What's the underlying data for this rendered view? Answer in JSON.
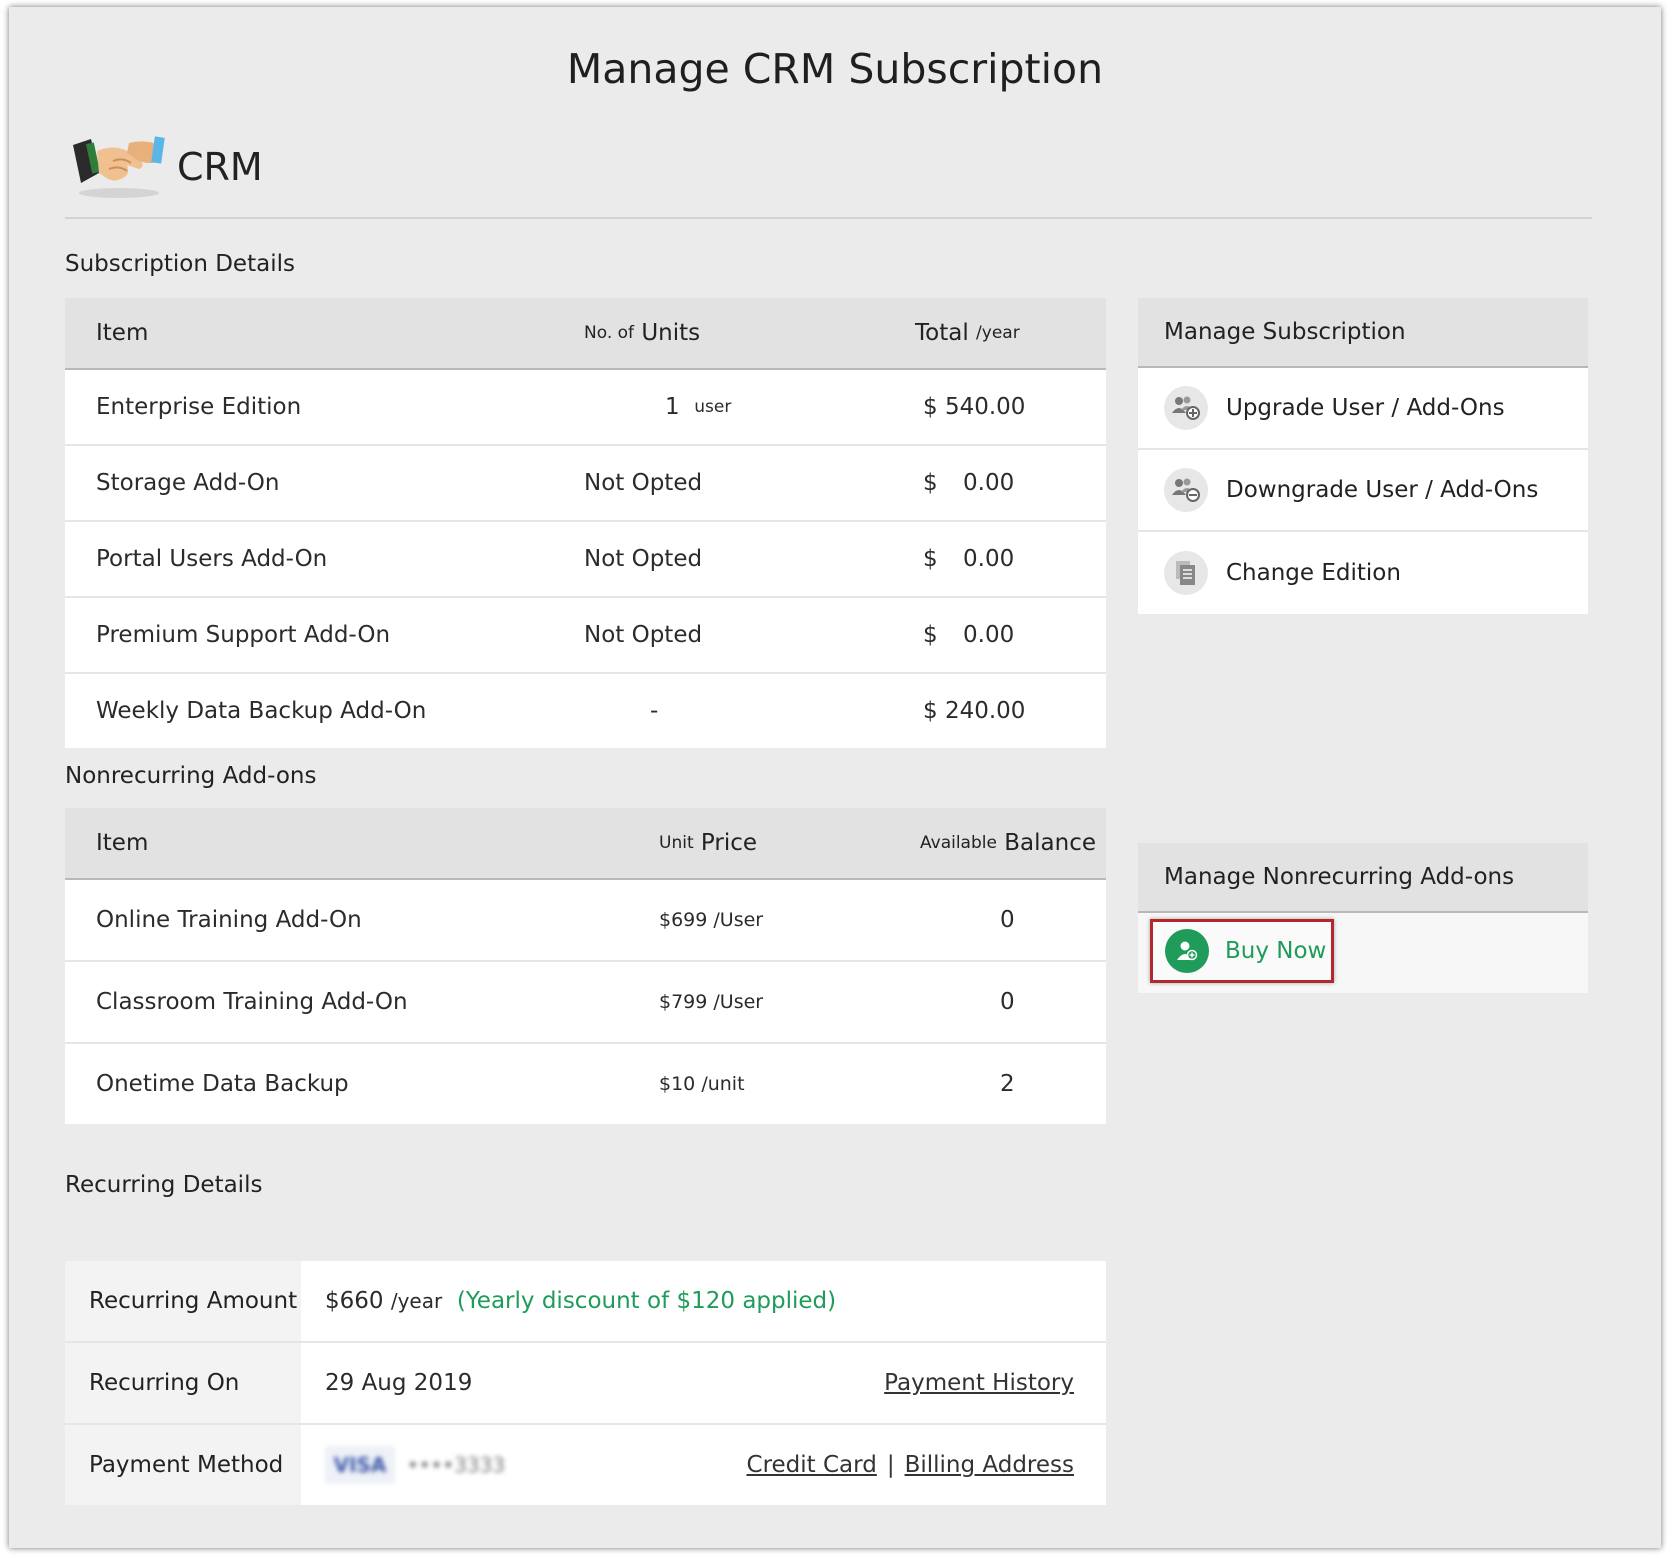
{
  "page_title": "Manage CRM Subscription",
  "app": {
    "name": "CRM",
    "logo_icon": "handshake-icon"
  },
  "subscription": {
    "section_title": "Subscription Details",
    "headers": {
      "item": "Item",
      "units_prefix": "No. of",
      "units": "Units",
      "total": "Total",
      "total_suffix": "/year"
    },
    "rows": [
      {
        "item": "Enterprise Edition",
        "units": "1",
        "units_unit": "user",
        "currency": "$",
        "amount": "540.00"
      },
      {
        "item": "Storage Add-On",
        "units": "Not Opted",
        "units_unit": "",
        "currency": "$",
        "amount": "0.00"
      },
      {
        "item": "Portal Users Add-On",
        "units": "Not Opted",
        "units_unit": "",
        "currency": "$",
        "amount": "0.00"
      },
      {
        "item": "Premium Support Add-On",
        "units": "Not Opted",
        "units_unit": "",
        "currency": "$",
        "amount": "0.00"
      },
      {
        "item": "Weekly Data Backup Add-On",
        "units": "-",
        "units_unit": "",
        "currency": "$",
        "amount": "240.00"
      }
    ]
  },
  "manage_subscription": {
    "title": "Manage Subscription",
    "items": [
      {
        "label": "Upgrade User / Add-Ons",
        "icon": "users-plus-icon"
      },
      {
        "label": "Downgrade User / Add-Ons",
        "icon": "users-minus-icon"
      },
      {
        "label": "Change Edition",
        "icon": "document-icon"
      }
    ]
  },
  "nonrecurring": {
    "section_title": "Nonrecurring Add-ons",
    "headers": {
      "item": "Item",
      "price_prefix": "Unit",
      "price": "Price",
      "balance_prefix": "Available",
      "balance": "Balance"
    },
    "rows": [
      {
        "item": "Online Training Add-On",
        "price": "$699",
        "price_unit": "/User",
        "balance": "0"
      },
      {
        "item": "Classroom Training Add-On",
        "price": "$799",
        "price_unit": "/User",
        "balance": "0"
      },
      {
        "item": "Onetime Data Backup",
        "price": "$10",
        "price_unit": "/unit",
        "balance": "2"
      }
    ]
  },
  "manage_nonrecurring": {
    "title": "Manage Nonrecurring Add-ons",
    "buy_now": "Buy Now",
    "buy_icon": "user-add-icon",
    "accent_color": "#1f9b5a",
    "highlight_color": "#b3282d"
  },
  "recurring": {
    "section_title": "Recurring Details",
    "amount_label": "Recurring Amount",
    "amount_value": "$660",
    "amount_unit": "/year",
    "discount_note": "(Yearly discount of $120 applied)",
    "on_label": "Recurring On",
    "on_value": "29 Aug 2019",
    "payment_history_link": "Payment History",
    "method_label": "Payment Method",
    "card_brand": "VISA",
    "card_number": "••••3333",
    "credit_card_link": "Credit Card",
    "separator": "|",
    "billing_address_link": "Billing Address"
  }
}
